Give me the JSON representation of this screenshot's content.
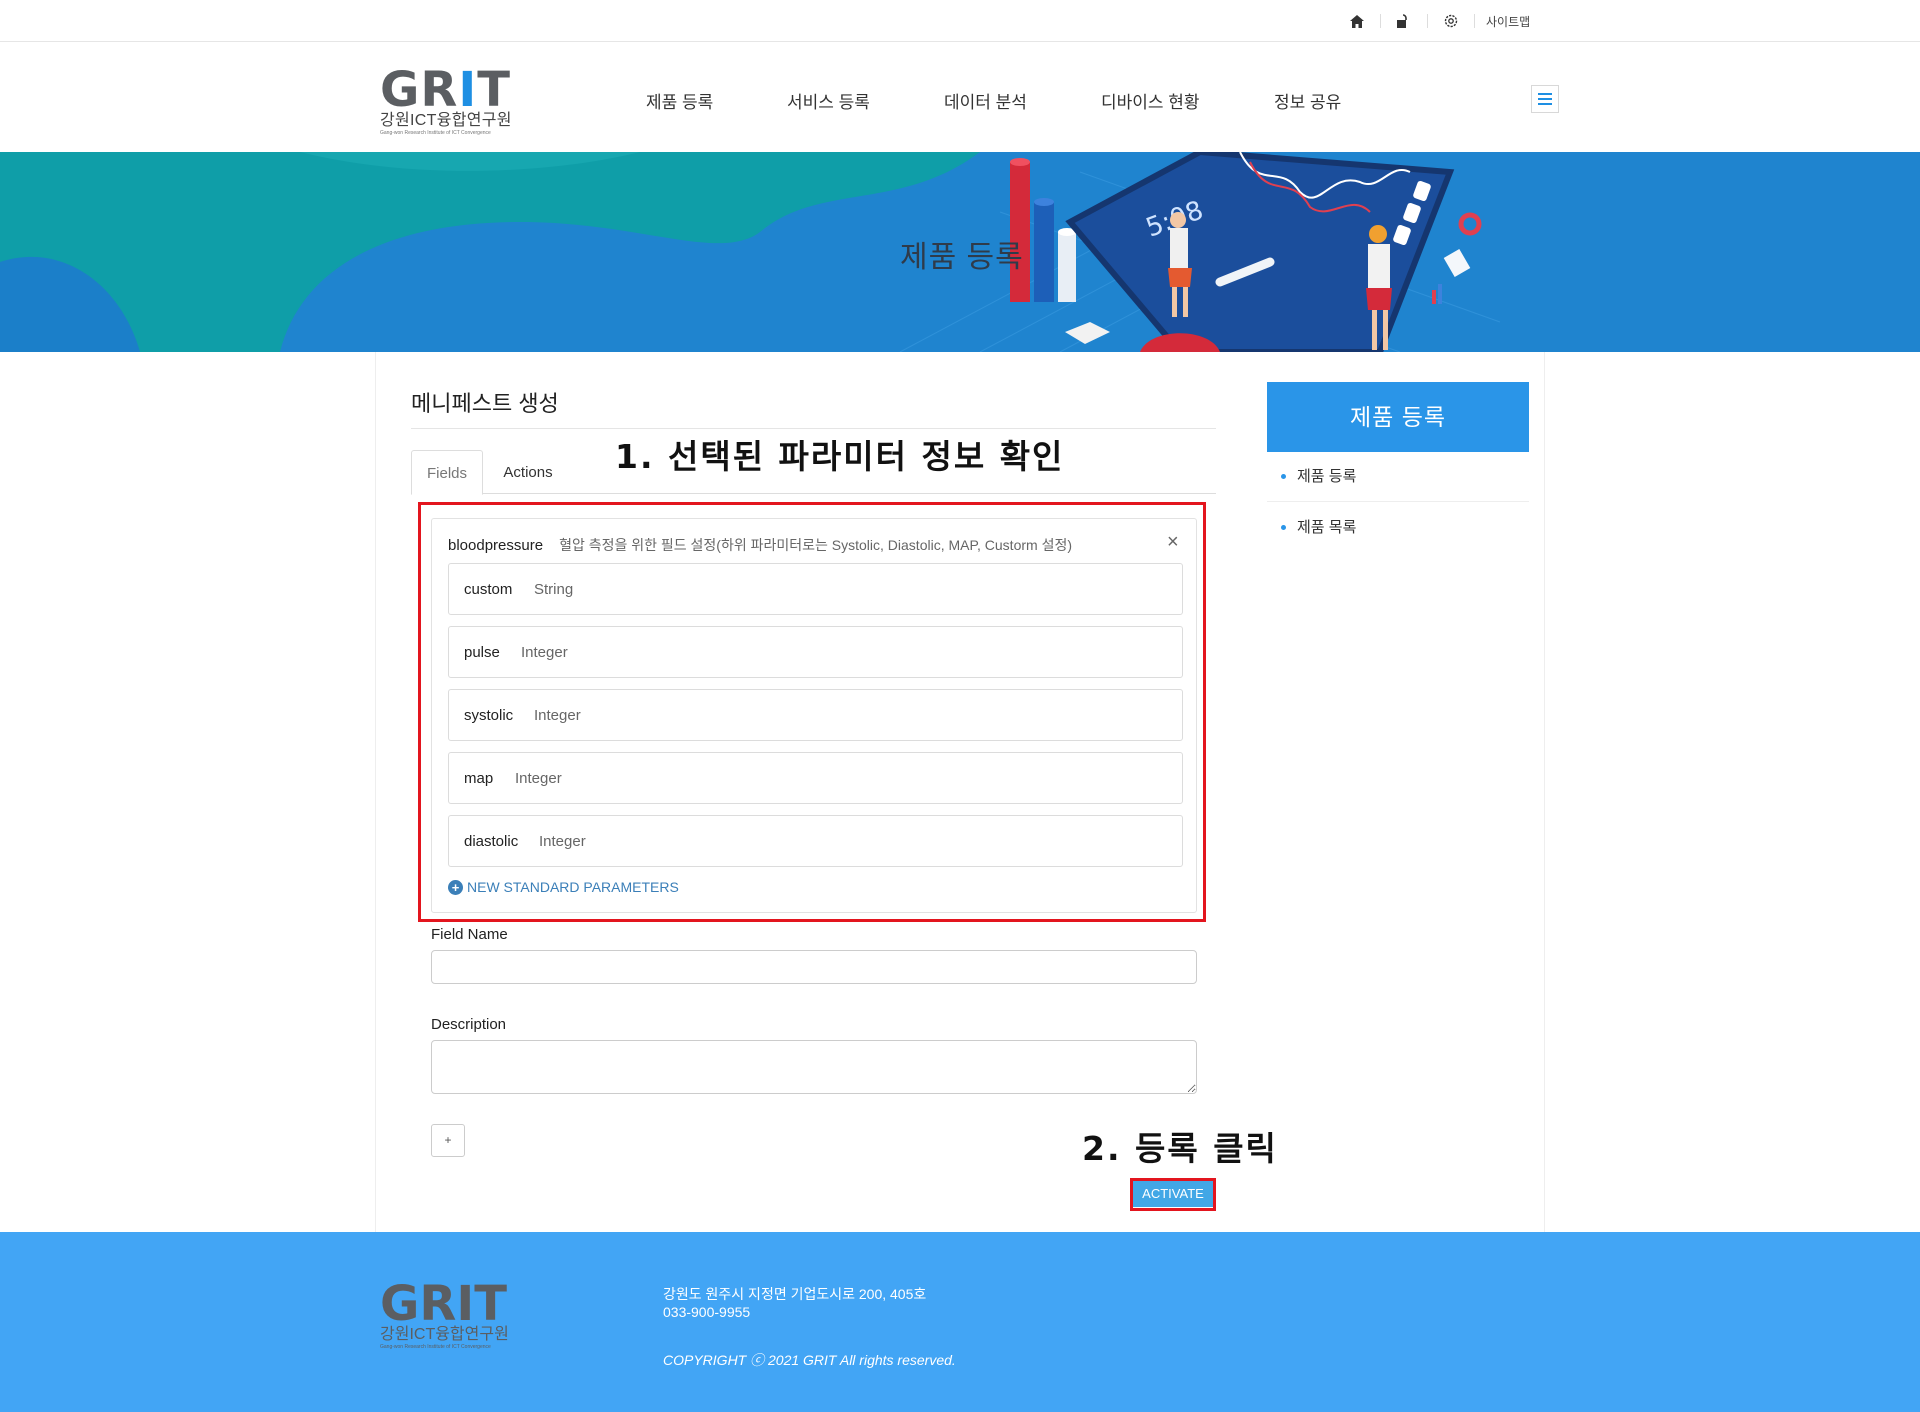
{
  "topbar": {
    "icons": [
      "home-icon",
      "unlock-icon",
      "gear-icon"
    ],
    "sitemap_label": "사이트맵"
  },
  "header": {
    "logo_text": "GRIT",
    "logo_korean": "강원ICT융합연구원",
    "logo_english": "Gang-won Research Institute of ICT Convergence",
    "nav": [
      "제품 등록",
      "서비스 등록",
      "데이터 분석",
      "디바이스 현황",
      "정보 공유"
    ]
  },
  "banner": {
    "title": "제품 등록"
  },
  "main": {
    "page_title": "메니페스트 생성",
    "annotation_1": "1. 선택된 파라미터 정보 확인",
    "annotation_2": "2. 등록 클릭",
    "tabs": [
      "Fields",
      "Actions"
    ],
    "field": {
      "name": "bloodpressure",
      "description": "혈압 측정을 위한 필드 설정(하위 파라미터로는 Systolic, Diastolic, MAP, Custorm 설정)",
      "close": "×",
      "parameters": [
        {
          "name": "custom",
          "type": "String"
        },
        {
          "name": "pulse",
          "type": "Integer"
        },
        {
          "name": "systolic",
          "type": "Integer"
        },
        {
          "name": "map",
          "type": "Integer"
        },
        {
          "name": "diastolic",
          "type": "Integer"
        }
      ],
      "new_standard_label": "NEW STANDARD PARAMETERS"
    },
    "form": {
      "field_name_label": "Field Name",
      "field_name_value": "",
      "description_label": "Description",
      "description_value": "",
      "add_label": "+",
      "activate_label": "ACTIVATE"
    }
  },
  "sidebar": {
    "heading": "제품 등록",
    "items": [
      "제품 등록",
      "제품 목록"
    ]
  },
  "footer": {
    "address": "강원도 원주시 지정면 기업도시로 200, 405호",
    "phone": "033-900-9955",
    "copyright": "COPYRIGHT ⓒ 2021 GRIT All rights reserved."
  },
  "colors": {
    "brand_blue": "#2a95e8",
    "banner_teal": "#0f9ea8",
    "footer_blue": "#42a5f5",
    "annotation_red": "#e3151e",
    "link_blue": "#3b7fb8"
  }
}
